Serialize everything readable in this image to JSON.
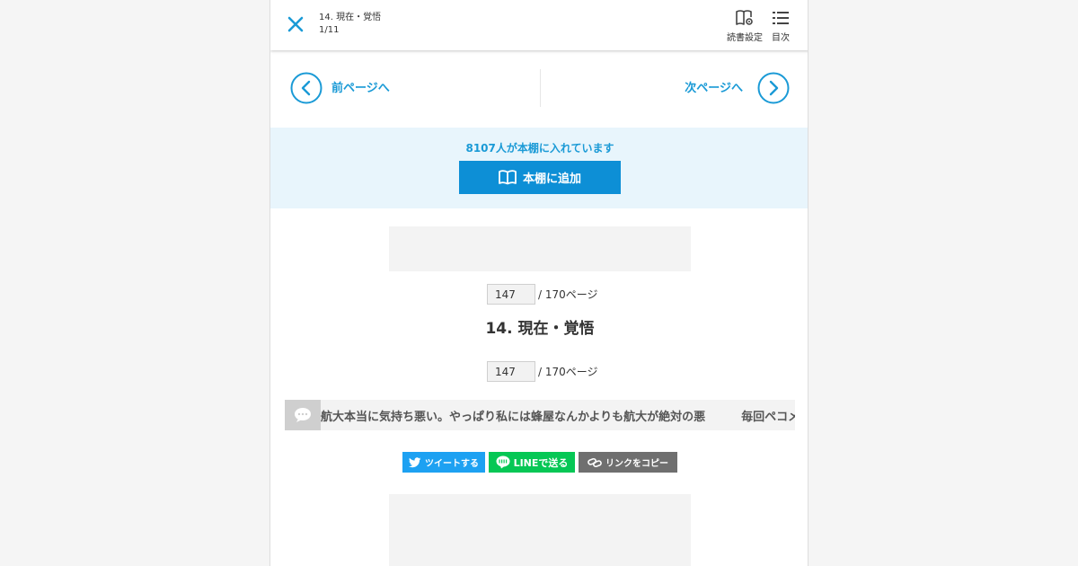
{
  "header": {
    "chapter_title": "14. 現在・覚悟",
    "chapter_count": "1/11",
    "reading_settings_label": "読書設定",
    "toc_label": "目次"
  },
  "pager": {
    "prev_label": "前ページへ",
    "next_label": "次ページへ"
  },
  "bookshelf": {
    "count_text": "8107人が本棚に入れています",
    "add_button_label": "本棚に追加"
  },
  "page_jump": {
    "current_page": "147",
    "total_text": "/ 170ページ"
  },
  "episode": {
    "title": "14. 現在・覚悟"
  },
  "comments": {
    "items": [
      "航大本当に気持ち悪い。やっぱり私には蜂屋なんかよりも航大が絶対の悪",
      "毎回ペコメ"
    ]
  },
  "share": {
    "twitter_label": "ツイートする",
    "line_label": "LINEで送る",
    "copy_label": "リンクをコピー"
  },
  "colors": {
    "accent": "#1a9ad6",
    "button_blue": "#0d8fd6",
    "bookshelf_bg": "#e8f5fc",
    "twitter": "#1da1f2",
    "line": "#06c755",
    "copy": "#6f6f6f"
  },
  "icons": {
    "close": "close-icon",
    "reading_settings": "book-gear-icon",
    "toc": "list-icon",
    "prev": "chevron-left-circle-icon",
    "next": "chevron-right-circle-icon",
    "bookshelf": "open-book-icon",
    "comment": "speech-bubble-icon",
    "twitter": "twitter-bird-icon",
    "line": "line-logo-icon",
    "copy": "link-icon"
  }
}
